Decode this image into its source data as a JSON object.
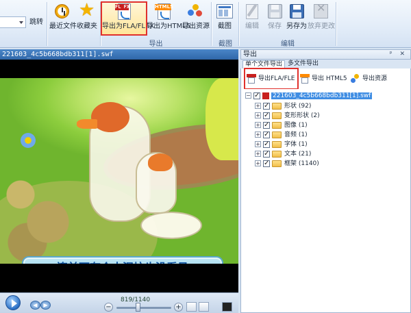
{
  "ribbon": {
    "goto_label": "跳转",
    "recent_label": "最近文件",
    "favorites_label": "收藏夹",
    "export_fla_label": "导出为FLA/FLEX",
    "export_html5_label": "导出为HTML5",
    "export_resources_label": "导出资源",
    "screenshot_label": "截图",
    "edit_label": "编辑",
    "save_label": "保存",
    "save_as_label": "另存为",
    "discard_label": "放弃更改",
    "group_export": "导出",
    "group_screenshot": "截图",
    "group_edit": "编辑",
    "fl_tag": "FL FX",
    "html5_tag": "HTML5"
  },
  "preview": {
    "title": "221603_4c5b668bdb311[1].swf",
    "subtitle_text": "连前面有个大泥坑也没看见",
    "frame_counter": "819/1140"
  },
  "export_panel": {
    "title": "导出",
    "tabs": [
      "单个文件导出",
      "多文件导出"
    ],
    "toolbar": {
      "fla": "导出FLA/FLE",
      "html5": "导出 HTML5",
      "resources": "导出资源"
    },
    "tree": {
      "root": "221603_4c5b668bdb311[1].swf",
      "children": [
        {
          "label": "形状 (92)"
        },
        {
          "label": "变形形状 (2)"
        },
        {
          "label": "图像 (1)"
        },
        {
          "label": "音频 (1)"
        },
        {
          "label": "字体 (1)"
        },
        {
          "label": "文本 (21)"
        },
        {
          "label": "框架 (1140)"
        }
      ]
    }
  },
  "colors": {
    "highlight": "#e0302c",
    "title_bar": "#2f66a8",
    "selection": "#3f8de3"
  }
}
